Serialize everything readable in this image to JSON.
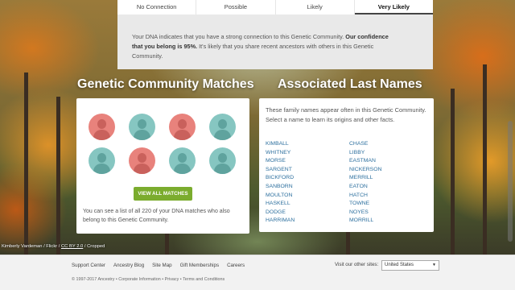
{
  "confidence": {
    "levels": [
      "No Connection",
      "Possible",
      "Likely",
      "Very Likely"
    ],
    "active_level": "Very Likely",
    "text_before": "Your DNA indicates that you have a strong connection to this Genetic Community. ",
    "text_bold": "Our confidence that you belong is 95%.",
    "text_after": " It's likely that you share recent ancestors with others in this Genetic Community."
  },
  "matches": {
    "heading": "Genetic Community Matches",
    "avatar_colors": [
      "red",
      "teal",
      "red",
      "teal",
      "teal",
      "red",
      "teal",
      "teal"
    ],
    "button_label": "VIEW ALL MATCHES",
    "note": "You can see a list of all 220 of your DNA matches who also belong to this Genetic Community."
  },
  "names": {
    "heading": "Associated Last Names",
    "intro": "These family names appear often in this Genetic Community. Select a name to learn its origins and other facts.",
    "left": [
      "KIMBALL",
      "WHITNEY",
      "MORSE",
      "SARGENT",
      "BICKFORD",
      "SANBORN",
      "MOULTON",
      "HASKELL",
      "DODGE",
      "HARRIMAN"
    ],
    "right": [
      "CHASE",
      "LIBBY",
      "EASTMAN",
      "NICKERSON",
      "MERRILL",
      "EATON",
      "HATCH",
      "TOWNE",
      "NOYES",
      "MORRILL"
    ]
  },
  "credit": {
    "prefix": "Kimberly Vardeman / Flickr / ",
    "license": "CC BY 2.0",
    "suffix": " / Cropped"
  },
  "footer": {
    "links": [
      "Support Center",
      "Ancestry Blog",
      "Site Map",
      "Gift Memberships",
      "Careers"
    ],
    "legal": "© 1997-2017 Ancestry • Corporate Information • Privacy • Terms and Conditions",
    "other_sites_label": "Visit our other sites:",
    "site_selected": "United States"
  },
  "colors": {
    "button_green": "#7bac2e",
    "avatar_red": "#e8827c",
    "avatar_teal": "#86c6c1",
    "link_blue": "#2c6f9e"
  }
}
